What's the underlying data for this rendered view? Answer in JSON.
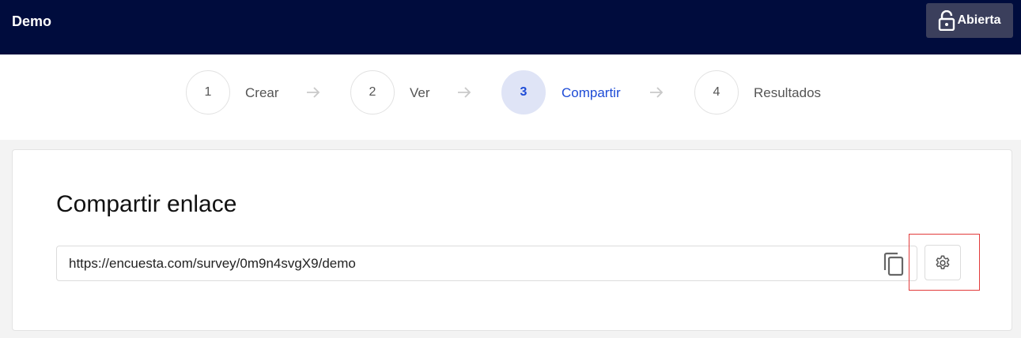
{
  "header": {
    "title": "Demo",
    "status_label": "Abierta",
    "status_icon": "unlock-icon"
  },
  "steps": [
    {
      "number": "1",
      "label": "Crear",
      "active": false
    },
    {
      "number": "2",
      "label": "Ver",
      "active": false
    },
    {
      "number": "3",
      "label": "Compartir",
      "active": true
    },
    {
      "number": "4",
      "label": "Resultados",
      "active": false
    }
  ],
  "share": {
    "title": "Compartir enlace",
    "url": "https://encuesta.com/survey/0m9n4svgX9/demo",
    "copy_icon": "copy-icon",
    "settings_icon": "gear-icon"
  },
  "colors": {
    "topbar": "#000c3d",
    "accent": "#1d4bd6",
    "active_step_bg": "#dfe4f6",
    "highlight": "#e23b3b"
  }
}
